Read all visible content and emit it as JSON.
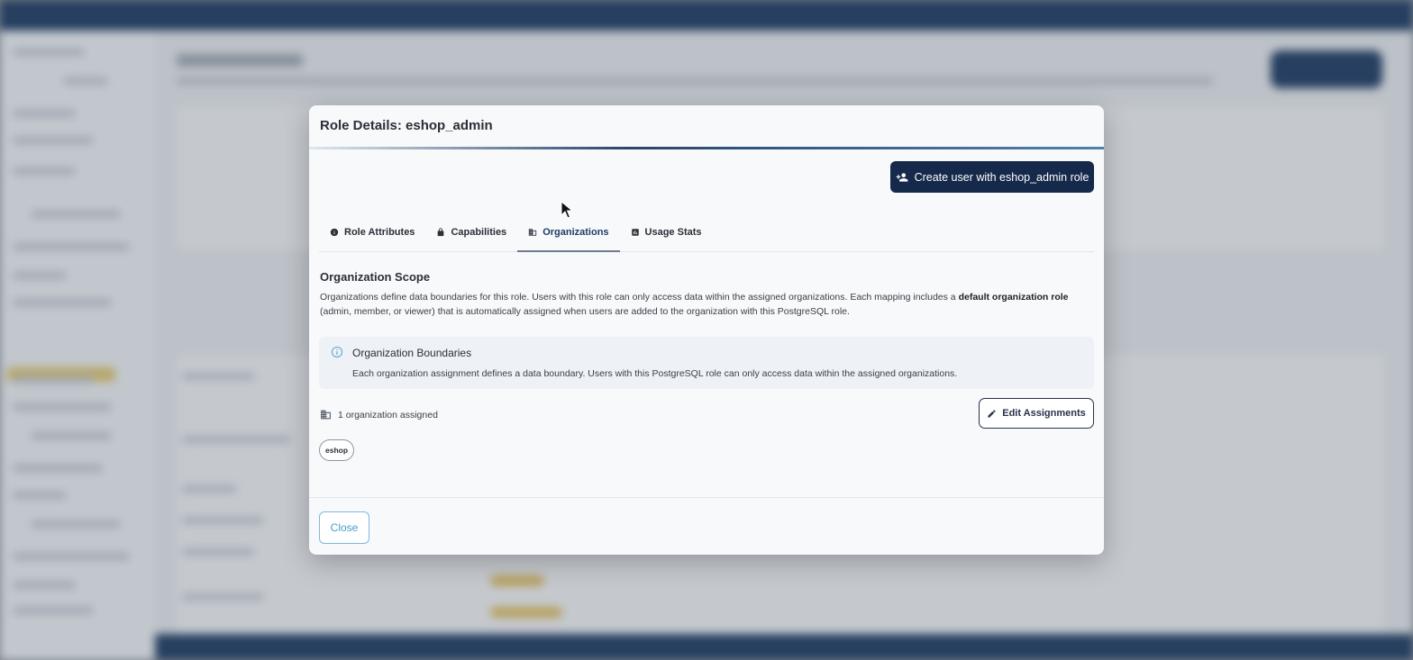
{
  "modal": {
    "title": "Role Details: eshop_admin",
    "create_button_label": "Create user with eshop_admin role",
    "tabs": [
      {
        "label": "Role Attributes",
        "icon": "info-circle-icon"
      },
      {
        "label": "Capabilities",
        "icon": "lock-icon"
      },
      {
        "label": "Organizations",
        "icon": "building-icon",
        "active": true
      },
      {
        "label": "Usage Stats",
        "icon": "stats-icon"
      }
    ],
    "section": {
      "title": "Organization Scope",
      "desc_part1": "Organizations define data boundaries for this role. Users with this role can only access data within the assigned organizations. Each mapping includes a ",
      "desc_bold": "default organization role",
      "desc_part2": " (admin, member, or viewer) that is automatically assigned when users are added to the organization with this PostgreSQL role."
    },
    "info": {
      "title": "Organization Boundaries",
      "text": "Each organization assignment defines a data boundary. Users with this PostgreSQL role can only access data within the assigned organizations."
    },
    "assigned_count_text": "1 organization assigned",
    "edit_button_label": "Edit Assignments",
    "organizations": [
      "eshop"
    ],
    "close_button_label": "Close"
  },
  "colors": {
    "primary_dark": "#15294a",
    "accent_blue": "#4a9ad0",
    "topbar": "#1f3c63"
  }
}
